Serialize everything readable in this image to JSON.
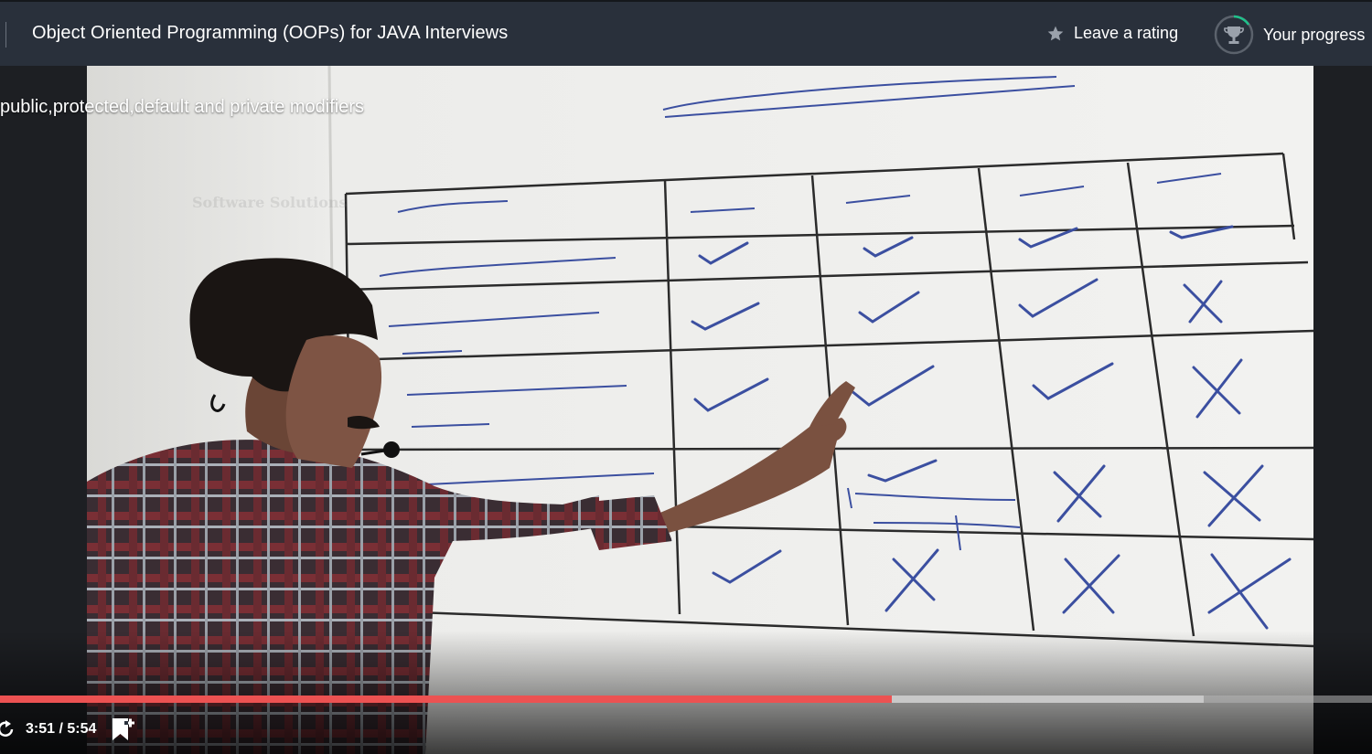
{
  "header": {
    "course_title": "Object Oriented Programming (OOPs) for JAVA Interviews",
    "rating_label": "Leave a rating",
    "progress_label": "Your progress"
  },
  "player": {
    "lecture_title": "public,protected,default and private modifiers",
    "watermark": "Software Solutions",
    "current_time": "3:51",
    "duration": "5:54",
    "time_display": "3:51 / 5:54",
    "played_fraction": 0.65,
    "buffered_fraction": 0.877
  },
  "whiteboard": {
    "heading": "Summary of public, protected, default, private",
    "columns": [
      "Visibility",
      "public",
      "protected",
      "default",
      "private"
    ],
    "rows": [
      {
        "label": "within the same class",
        "marks": [
          "check",
          "check",
          "check",
          "check"
        ]
      },
      {
        "label": "from child class of same package",
        "marks": [
          "check",
          "check",
          "check",
          "cross"
        ]
      },
      {
        "label": "from Non-child class of same package",
        "marks": [
          "check",
          "check",
          "check",
          "cross"
        ]
      },
      {
        "label": "from child class of outside package",
        "marks": [
          "check",
          "check",
          "cross",
          "cross"
        ]
      },
      {
        "label": "from non-child class of outside package",
        "marks": [
          "check",
          "cross",
          "cross",
          "cross"
        ]
      }
    ],
    "note": "[we should use child ref only]"
  },
  "colors": {
    "topbar": "#29303b",
    "progress_played": "#ec5252",
    "marker": "#3b4fa0"
  },
  "icons": {
    "rating": "star-icon",
    "progress": "trophy-icon",
    "replay": "replay-icon",
    "bookmark": "add-bookmark-icon"
  }
}
